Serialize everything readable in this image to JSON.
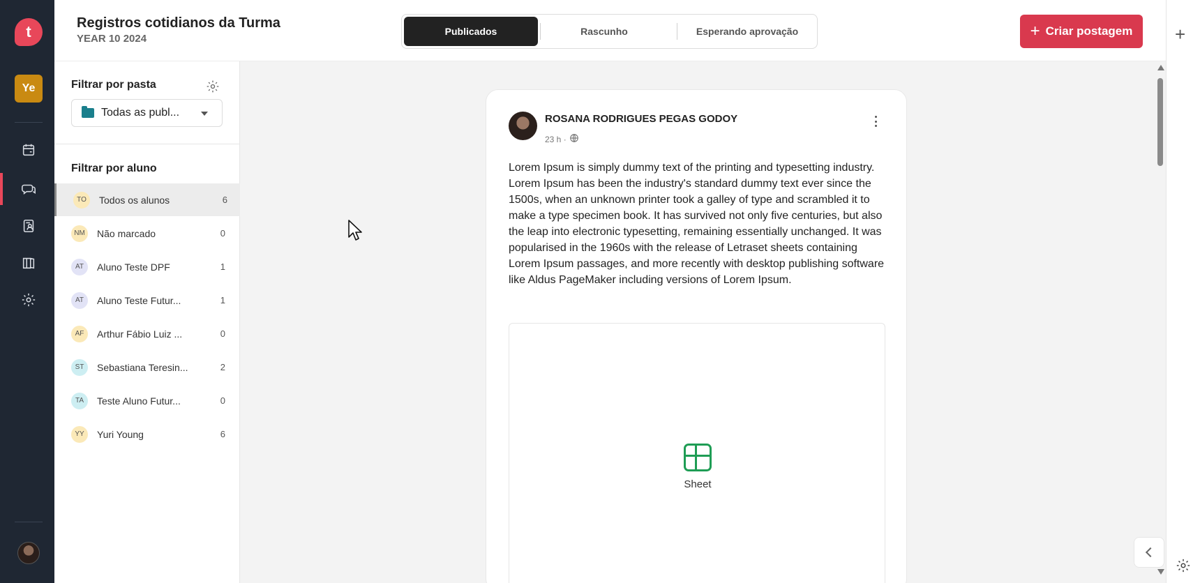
{
  "rail": {
    "logo_letter": "t",
    "class_avatar": "Ye"
  },
  "header": {
    "title": "Registros cotidianos da Turma",
    "subtitle": "YEAR 10 2024",
    "tabs": [
      "Publicados",
      "Rascunho",
      "Esperando aprovação"
    ],
    "active_tab": "Publicados",
    "create_button": "Criar postagem"
  },
  "filters": {
    "folder_title": "Filtrar por pasta",
    "folder_selected": "Todas as publ...",
    "student_title": "Filtrar por aluno",
    "students": [
      {
        "initials": "TO",
        "name": "Todos os alunos",
        "count": "6"
      },
      {
        "initials": "NM",
        "name": "Não marcado",
        "count": "0"
      },
      {
        "initials": "AT",
        "name": "Aluno Teste DPF",
        "count": "1"
      },
      {
        "initials": "AT",
        "name": "Aluno Teste Futur...",
        "count": "1"
      },
      {
        "initials": "AF",
        "name": "Arthur Fábio Luiz ...",
        "count": "0"
      },
      {
        "initials": "ST",
        "name": "Sebastiana Teresin...",
        "count": "2"
      },
      {
        "initials": "TA",
        "name": "Teste Aluno Futur...",
        "count": "0"
      },
      {
        "initials": "YY",
        "name": "Yuri Young",
        "count": "6"
      }
    ]
  },
  "post": {
    "author": "ROSANA RODRIGUES PEGAS GODOY",
    "time": "23 h ·",
    "body": "Lorem Ipsum is simply dummy text of the printing and typesetting industry. Lorem Ipsum has been the industry's standard dummy text ever since the 1500s, when an unknown printer took a galley of type and scrambled it to make a type specimen book. It has survived not only five centuries, but also the leap into electronic typesetting, remaining essentially unchanged. It was popularised in the 1960s with the release of Letraset sheets containing Lorem Ipsum passages, and more recently with desktop publishing software like Aldus PageMaker including versions of Lorem Ipsum.",
    "attachment_label": "Sheet"
  },
  "colors": {
    "rail_bg": "#1f2733",
    "brand": "#e8475a",
    "create_button": "#d9394e",
    "sheet_icon": "#1f9d55"
  }
}
